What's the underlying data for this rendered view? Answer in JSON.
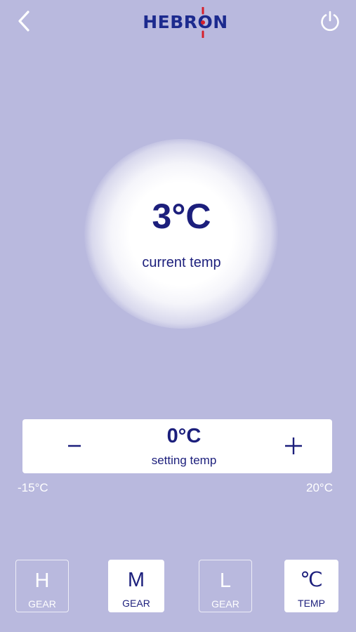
{
  "header": {
    "brand": "HEBRON",
    "back_icon": "chevron-left-icon",
    "power_icon": "power-icon"
  },
  "current": {
    "value": "3°C",
    "label": "current temp"
  },
  "setting": {
    "value": "0°C",
    "label": "setting temp",
    "decrement_label": "−",
    "increment_label": "+",
    "min": "-15°C",
    "max": "20°C"
  },
  "modes": [
    {
      "letter": "H",
      "label": "GEAR",
      "active": false
    },
    {
      "letter": "M",
      "label": "GEAR",
      "active": true
    },
    {
      "letter": "L",
      "label": "GEAR",
      "active": false
    },
    {
      "letter": "℃",
      "label": "TEMP",
      "active": true
    }
  ],
  "colors": {
    "background": "#b9b9de",
    "primary_text": "#1c1f7c",
    "logo_blue": "#1c2a8e",
    "logo_accent": "#d6202b"
  }
}
